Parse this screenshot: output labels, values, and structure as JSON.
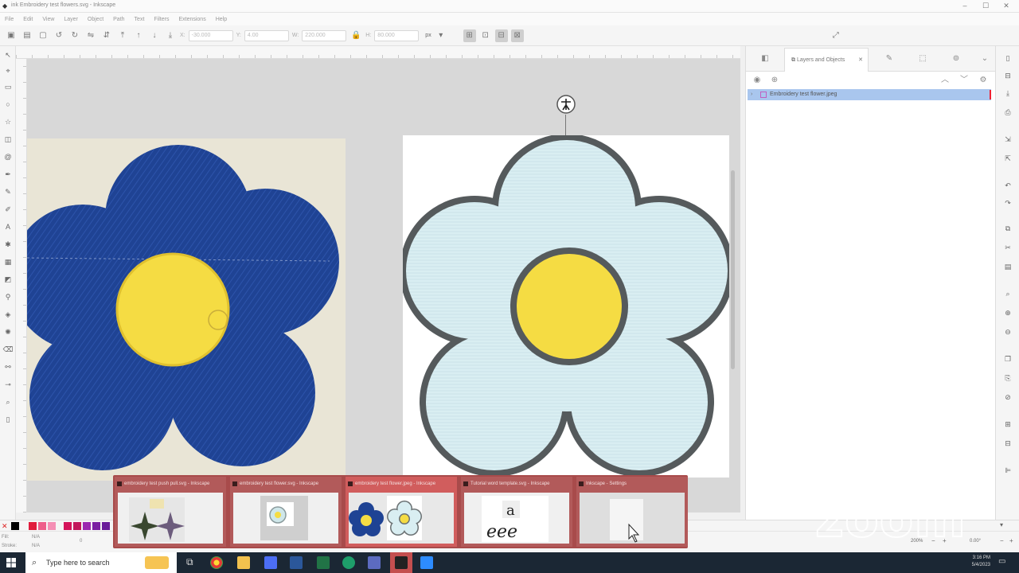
{
  "window": {
    "title": "ink Embroidery test flowers.svg - Inkscape",
    "controls": [
      "–",
      "☐",
      "✕"
    ]
  },
  "menu": [
    "File",
    "Edit",
    "View",
    "Layer",
    "Object",
    "Path",
    "Text",
    "Filters",
    "Extensions",
    "Help"
  ],
  "toolbar": {
    "x_label": "X:",
    "x_value": "-30.000",
    "y_label": "Y:",
    "y_value": "4.00",
    "w_label": "W:",
    "w_value": "220.000",
    "h_label": "H:",
    "h_value": "80.000",
    "unit": "px"
  },
  "dock": {
    "active_tab": "Layers and Objects",
    "layer_name": "Embroidery test flower.jpeg"
  },
  "thumbnails": [
    {
      "title": "embroidery test push pull.svg - Inkscape"
    },
    {
      "title": "embroidery test flower.svg - Inkscape"
    },
    {
      "title": "embroidery test flower.jpeg - Inkscape"
    },
    {
      "title": "Tutorial word template.svg - Inkscape"
    },
    {
      "title": "Inkscape - Settings"
    }
  ],
  "status": {
    "fill_label": "Fill:",
    "fill_value": "N/A",
    "stroke_label": "Stroke:",
    "stroke_value": "N/A",
    "opacity_value": "0",
    "zoom_value": "200%",
    "rotation_value": "0.00°"
  },
  "watermark": "zoom",
  "taskbar": {
    "search_placeholder": "Type here to search",
    "time": "3:16 PM",
    "date": "5/4/2023"
  },
  "colors": {
    "photo_petal": "#1f4394",
    "design_petal": "#d9eef2",
    "outline": "#555a5c",
    "center": "#f5dc43",
    "layer_highlight": "#a9c6ee",
    "thumb_strip": "#a84b4b"
  }
}
